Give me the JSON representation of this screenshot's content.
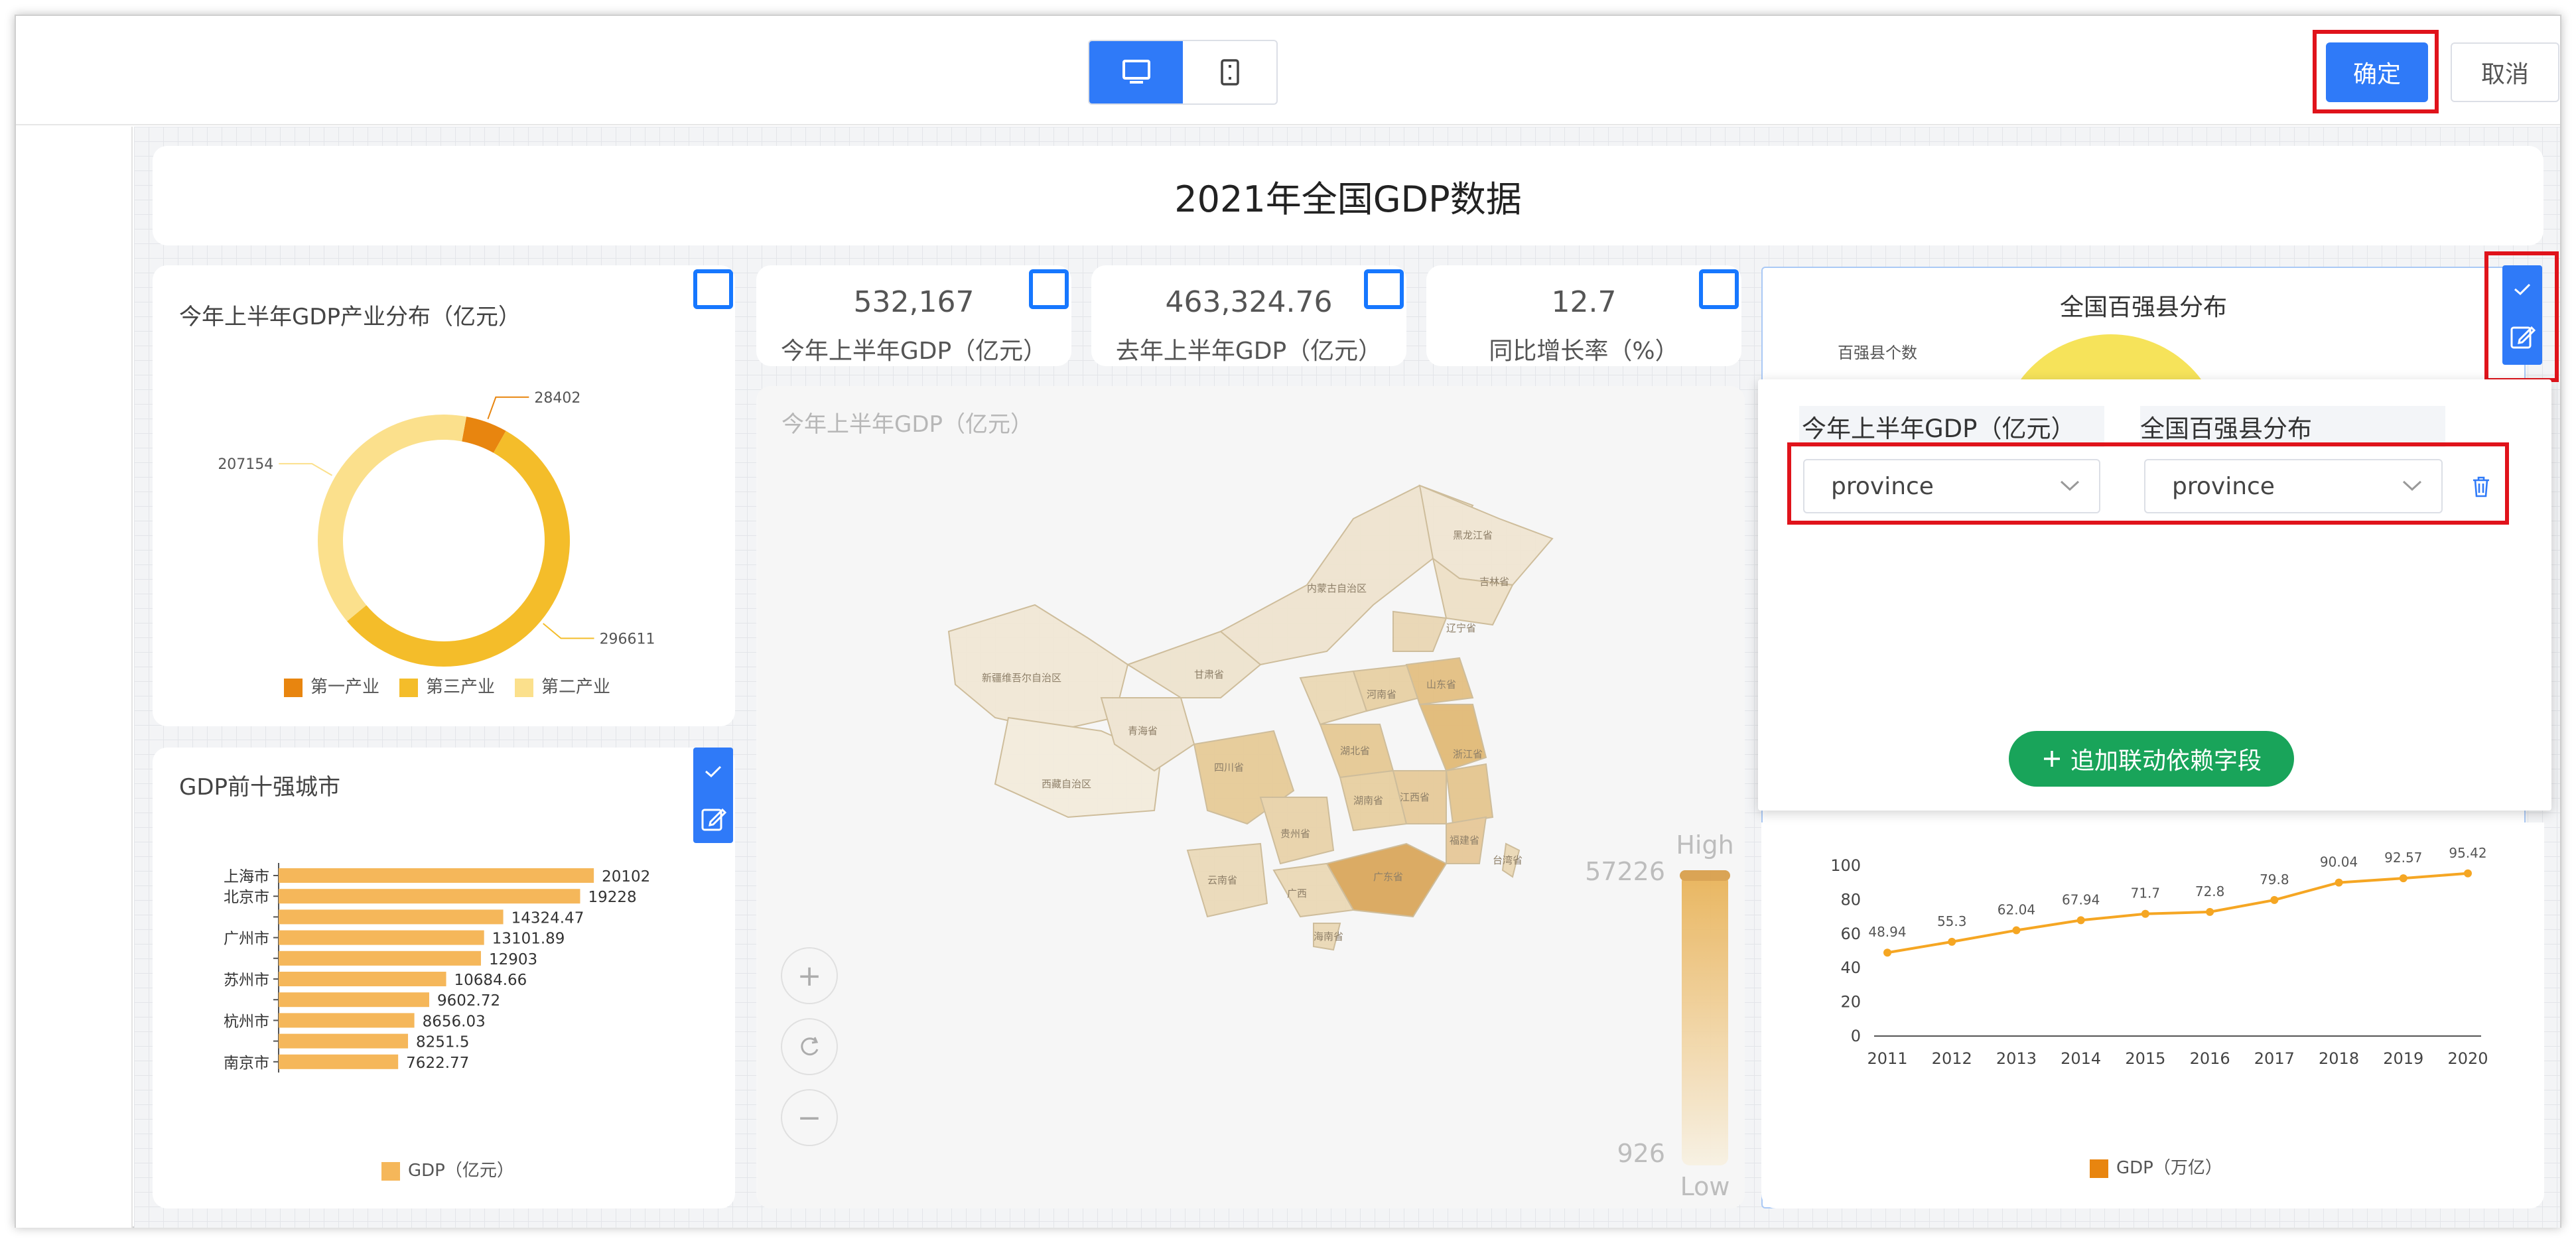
{
  "header": {
    "device_desktop_icon": "monitor-icon",
    "device_mobile_icon": "phone-icon",
    "confirm_label": "确定",
    "cancel_label": "取消"
  },
  "dashboard": {
    "title": "2021年全国GDP数据",
    "industry_card": {
      "title": "今年上半年GDP产业分布（亿元）",
      "legend": [
        "第一产业",
        "第三产业",
        "第二产业"
      ],
      "colors": [
        "#e8850f",
        "#f4bd2a",
        "#fbe08c"
      ]
    },
    "kpis": [
      {
        "value": "532,167",
        "label": "今年上半年GDP（亿元）"
      },
      {
        "value": "463,324.76",
        "label": "去年上半年GDP（亿元）"
      },
      {
        "value": "12.7",
        "label": "同比增长率（%）"
      }
    ],
    "map_card": {
      "title": "今年上半年GDP（亿元）",
      "visualmap_high": "High",
      "visualmap_low": "Low",
      "visualmap_max": "57226",
      "visualmap_min": "926",
      "zoom_in": "+",
      "zoom_out": "−",
      "provinces": [
        "新疆维吾尔自治区",
        "西藏自治区",
        "青海省",
        "甘肃省",
        "内蒙古自治区",
        "黑龙江省",
        "吉林省",
        "辽宁省",
        "四川省",
        "云南省",
        "贵州省",
        "广西",
        "海南省",
        "山东省",
        "河南省",
        "湖北省",
        "湖南省",
        "江西省",
        "浙江省",
        "福建省",
        "广东省",
        "台湾省"
      ]
    },
    "top100_card": {
      "title": "全国百强县分布",
      "legend_label": "百强县个数"
    },
    "city_card": {
      "title": "GDP前十强城市",
      "legend": "GDP（亿元）"
    },
    "trend_card": {
      "legend": "GDP（万亿）"
    },
    "link_panel": {
      "col1_header": "今年上半年GDP（亿元）",
      "col2_header": "全国百强县分布",
      "col1_value": "province",
      "col2_value": "province",
      "add_label": "追加联动依赖字段",
      "delete_icon": "trash-icon"
    }
  },
  "chart_data": [
    {
      "type": "pie",
      "title": "今年上半年GDP产业分布（亿元）",
      "categories": [
        "第一产业",
        "第三产业",
        "第二产业"
      ],
      "values": [
        28402,
        296611,
        207154
      ],
      "data_labels": [
        "28402",
        "296611",
        "207154"
      ],
      "legend": "bottom"
    },
    {
      "type": "bar",
      "title": "GDP前十强城市",
      "categories": [
        "上海市",
        "北京市",
        "",
        "广州市",
        "",
        "苏州市",
        "",
        "杭州市",
        "",
        "南京市"
      ],
      "values": [
        20102,
        19228,
        14324.47,
        13101.89,
        12903,
        10684.66,
        9602.72,
        8656.03,
        8251.5,
        7622.77
      ],
      "data_labels": [
        "20102",
        "19228",
        "14324.47",
        "13101.89",
        "12903",
        "10684.66",
        "9602.72",
        "8656.03",
        "8251.5",
        "7622.77"
      ],
      "series": [
        {
          "name": "GDP（亿元）",
          "values": [
            20102,
            19228,
            14324.47,
            13101.89,
            12903,
            10684.66,
            9602.72,
            8656.03,
            8251.5,
            7622.77
          ]
        }
      ],
      "xlim": [
        0,
        22000
      ],
      "legend": "bottom"
    },
    {
      "type": "line",
      "categories": [
        "2011",
        "2012",
        "2013",
        "2014",
        "2015",
        "2016",
        "2017",
        "2018",
        "2019",
        "2020"
      ],
      "values": [
        48.94,
        55.3,
        62.04,
        67.94,
        71.7,
        72.8,
        79.8,
        90.04,
        92.57,
        95.42
      ],
      "data_labels": [
        "48.94",
        "55.3",
        "62.04",
        "67.94",
        "71.7",
        "72.8",
        "79.8",
        "90.04",
        "92.57",
        "95.42"
      ],
      "series": [
        {
          "name": "GDP（万亿）",
          "values": [
            48.94,
            55.3,
            62.04,
            67.94,
            71.7,
            72.8,
            79.8,
            90.04,
            92.57,
            95.42
          ]
        }
      ],
      "yticks": [
        "0",
        "20",
        "40",
        "60",
        "80",
        "100"
      ],
      "ylim": [
        0,
        100
      ],
      "legend": "bottom"
    }
  ]
}
